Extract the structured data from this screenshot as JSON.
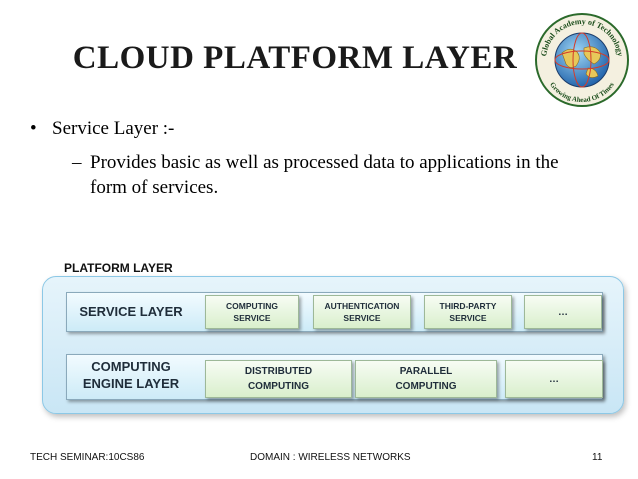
{
  "slide": {
    "title": "CLOUD PLATFORM LAYER",
    "bullet": "Service Layer :-",
    "sub_bullet": "Provides basic as well as processed data to applications in the form of services."
  },
  "logo": {
    "text_top": "Global Academy of Technology",
    "text_bottom": "Growing Ahead Of Times",
    "icon": "globe-logo-icon"
  },
  "diagram": {
    "platform_label": "PLATFORM LAYER",
    "service_layer": {
      "label": "SERVICE LAYER",
      "services": [
        {
          "line1": "COMPUTING",
          "line2": "SERVICE"
        },
        {
          "line1": "AUTHENTICATION",
          "line2": "SERVICE"
        },
        {
          "line1": "THIRD-PARTY",
          "line2": "SERVICE"
        },
        {
          "line1": "…",
          "line2": ""
        }
      ]
    },
    "engine_layer": {
      "label_line1": "COMPUTING",
      "label_line2": "ENGINE LAYER",
      "engines": [
        {
          "line1": "DISTRIBUTED",
          "line2": "COMPUTING"
        },
        {
          "line1": "PARALLEL",
          "line2": "COMPUTING"
        },
        {
          "line1": "…",
          "line2": ""
        }
      ]
    }
  },
  "footer": {
    "left": "TECH SEMINAR:10CS86",
    "center": "DOMAIN : WIRELESS NETWORKS",
    "page": "11"
  },
  "colors": {
    "platform_fill": "#c9e6f5",
    "layer_fill": "#cdebf7",
    "service_fill": "#d9efcc"
  }
}
